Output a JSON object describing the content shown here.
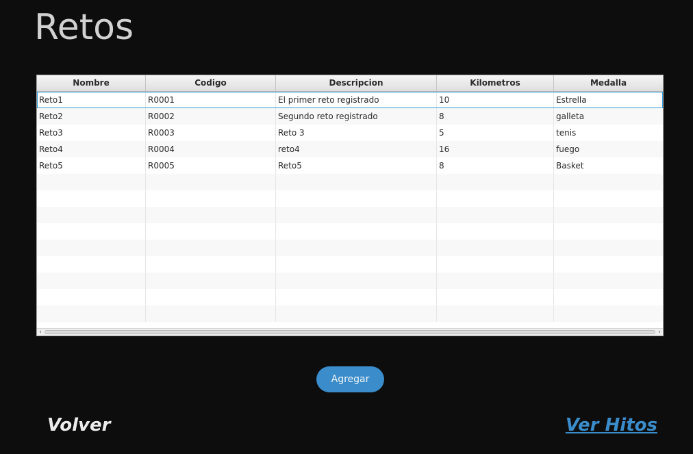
{
  "page": {
    "title": "Retos"
  },
  "table": {
    "columns": [
      "Nombre",
      "Codigo",
      "Descripcion",
      "Kilometros",
      "Medalla"
    ],
    "rows": [
      [
        "Reto1",
        "R0001",
        "El primer reto registrado",
        "10",
        "Estrella"
      ],
      [
        "Reto2",
        "R0002",
        "Segundo reto registrado",
        "8",
        "galleta"
      ],
      [
        "Reto3",
        "R0003",
        "Reto 3",
        "5",
        "tenis"
      ],
      [
        "Reto4",
        "R0004",
        "reto4",
        "16",
        "fuego"
      ],
      [
        "Reto5",
        "R0005",
        "Reto5",
        "8",
        "Basket"
      ]
    ],
    "empty_rows": 9,
    "selected_row": 0
  },
  "actions": {
    "add_label": "Agregar",
    "back_label": "Volver",
    "hitos_label": "Ver Hitos"
  },
  "colors": {
    "background": "#0d0d0d",
    "accent": "#3a8cca",
    "title": "#d2d2d2"
  }
}
